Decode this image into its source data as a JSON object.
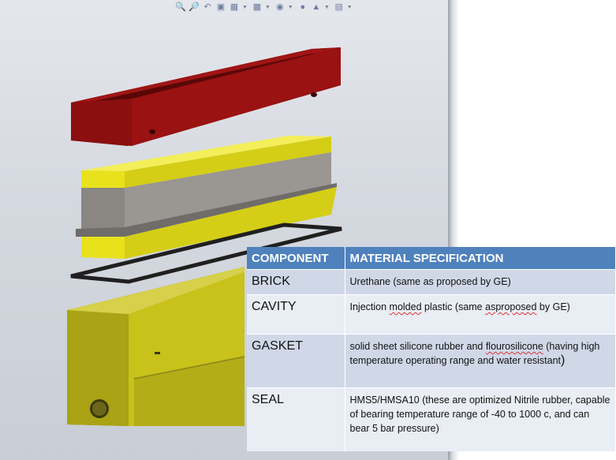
{
  "toolbar": {
    "icons": [
      "zoom-to-fit-icon",
      "zoom-to-area-icon",
      "previous-view-icon",
      "section-view-icon",
      "view-orientation-icon",
      "display-style-icon",
      "hide-show-items-icon",
      "edit-appearance-icon",
      "apply-scene-icon",
      "view-settings-icon"
    ]
  },
  "colors": {
    "cover_red": "#8b0f0f",
    "brick_yellow": "#e8e21c",
    "cavity_gray": "#8a8783",
    "gasket_dark": "#2a2a2a",
    "base_olive": "#b8b21a",
    "header_blue": "#4f81bd",
    "row_light": "#e9edf4",
    "row_dark": "#d0d8e8"
  },
  "table": {
    "headers": [
      "COMPONENT",
      "MATERIAL SPECIFICATION"
    ],
    "rows": [
      {
        "component": "BRICK",
        "spec": [
          "Urethane (same as proposed by GE)"
        ]
      },
      {
        "component": "CAVITY",
        "spec": [
          "Injection ",
          "molded",
          " plastic (same ",
          "asproposed",
          " by GE)"
        ]
      },
      {
        "component": "GASKET",
        "spec": [
          "solid sheet silicone rubber and ",
          "flourosilicone",
          " (having high temperature operating range and water resistant",
          ")"
        ]
      },
      {
        "component": "SEAL",
        "spec": [
          "HMS5/HMSA10  (these are optimized Nitrile rubber, capable of bearing  temperature range of  -40  to  1000  c, and can bear 5 bar      pressure)"
        ]
      }
    ]
  }
}
